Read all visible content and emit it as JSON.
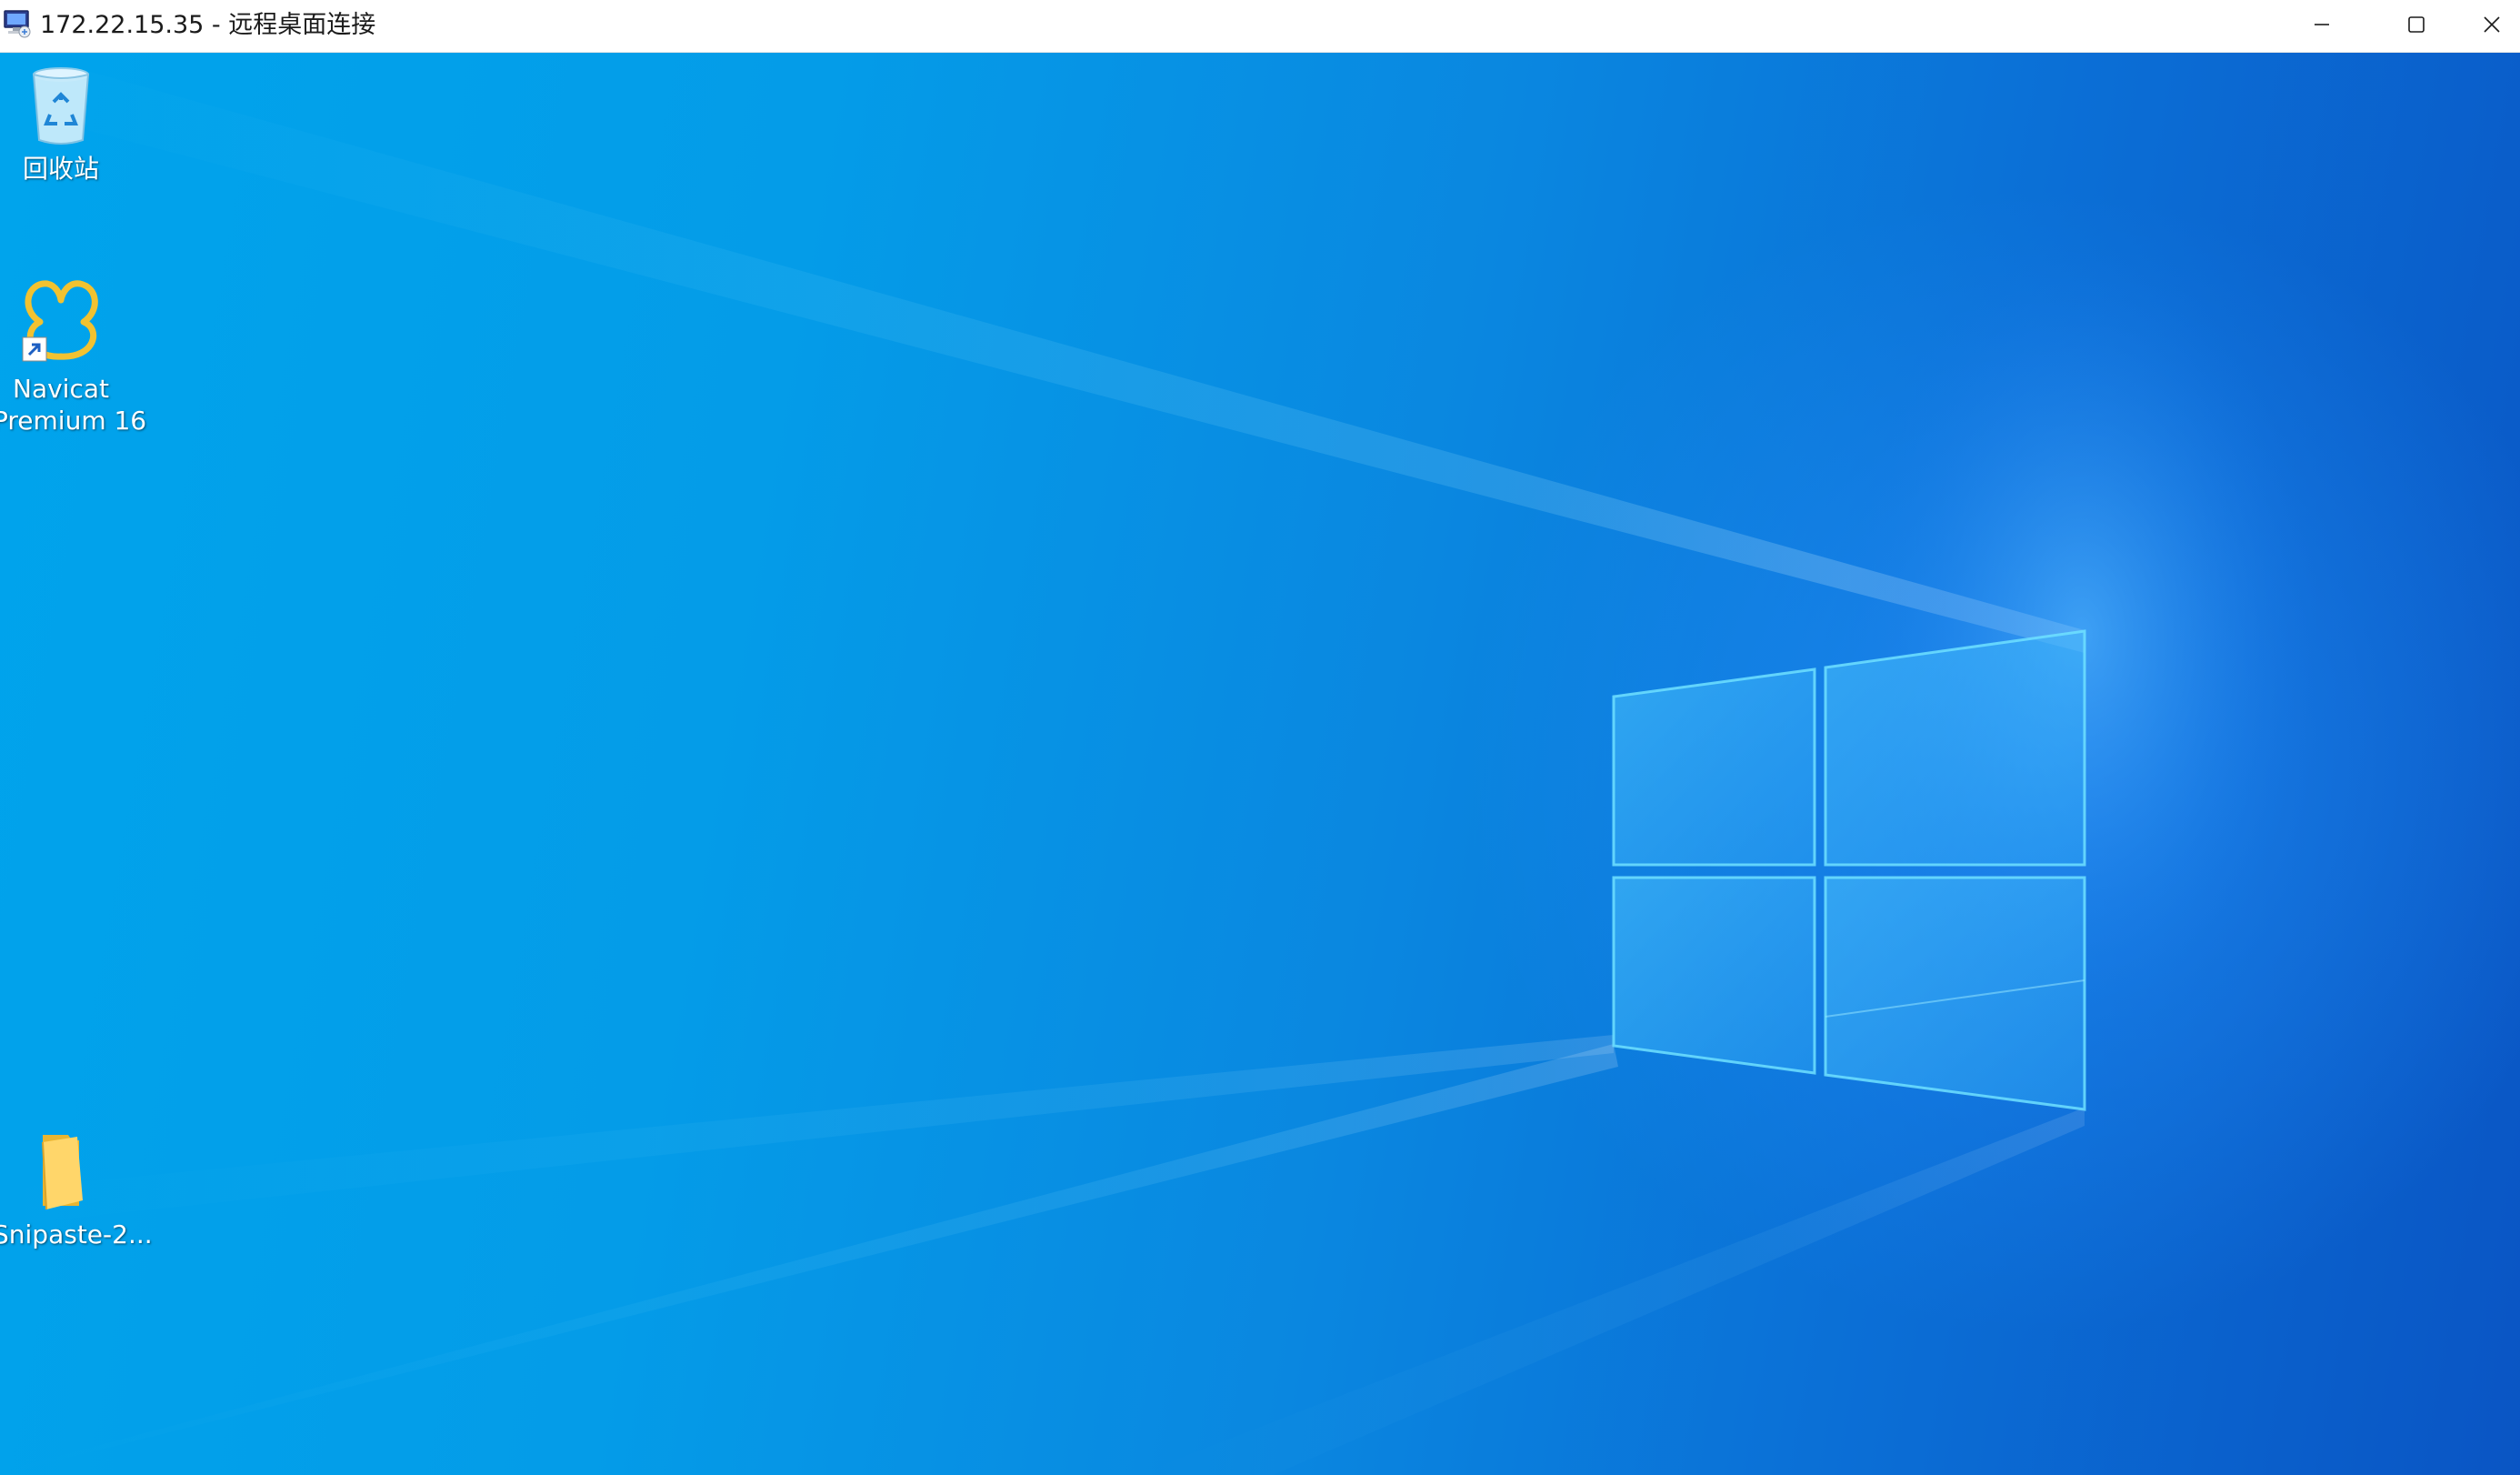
{
  "window": {
    "title": "172.22.15.35 - 远程桌面连接",
    "app_icon": "remote-desktop-icon",
    "controls": {
      "minimize_icon": "minimize-icon",
      "maximize_icon": "maximize-icon",
      "close_icon": "close-icon"
    }
  },
  "desktop": {
    "wallpaper": "windows-10-hero",
    "colors": {
      "light": "#00a4ec",
      "mid": "#0a87e0",
      "dark": "#0a55c4",
      "window_logo": "#5fd0ff"
    },
    "icons": [
      {
        "label": "回收站",
        "icon": "recycle-bin-icon"
      },
      {
        "label_line1": "Navicat",
        "label_line2": "Premium 16",
        "icon": "navicat-icon",
        "shortcut": true
      },
      {
        "label": "Snipaste-2...",
        "icon": "folder-icon"
      }
    ]
  }
}
